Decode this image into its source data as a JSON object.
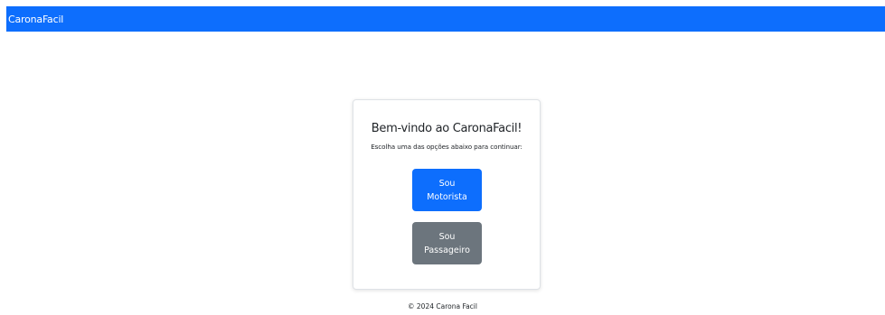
{
  "navbar": {
    "brand": "CaronaFacil",
    "color": "#0d6efd"
  },
  "card": {
    "title": "Bem-vindo ao CaronaFacil!",
    "subtitle": "Escolha uma das opções abaixo para continuar:",
    "buttons": {
      "driver_label": "Sou Motorista",
      "passenger_label": "Sou Passageiro"
    }
  },
  "footer": {
    "text": "© 2024 Carona Facil"
  },
  "colors": {
    "primary": "#0d6efd",
    "secondary": "#6c757d"
  }
}
